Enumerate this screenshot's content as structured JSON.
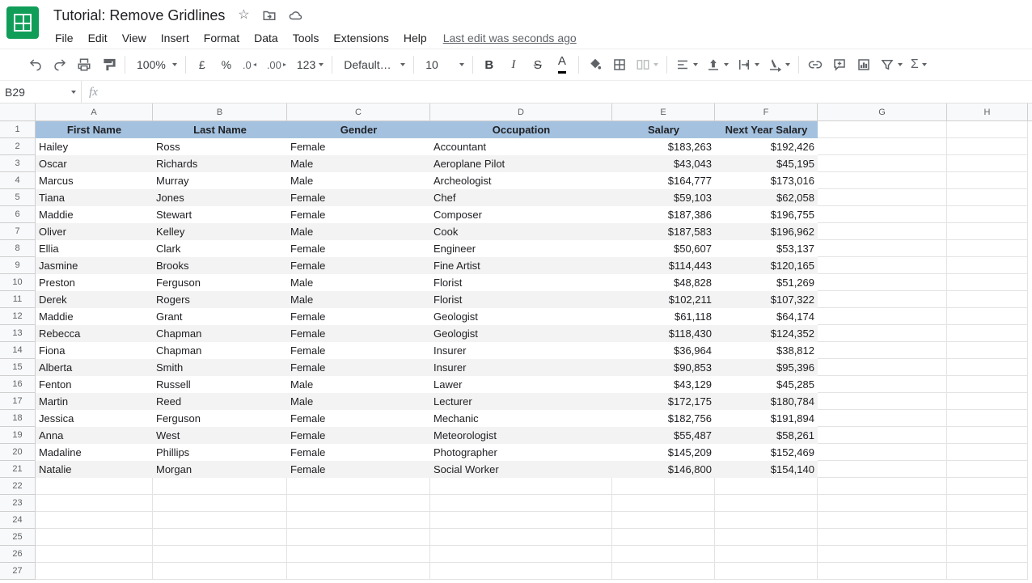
{
  "doc": {
    "title": "Tutorial: Remove Gridlines",
    "last_edit": "Last edit was seconds ago"
  },
  "menu": [
    "File",
    "Edit",
    "View",
    "Insert",
    "Format",
    "Data",
    "Tools",
    "Extensions",
    "Help"
  ],
  "toolbar": {
    "zoom": "100%",
    "currency_symbol": "£",
    "number_format_label": "123",
    "font_name": "Default (Ari…",
    "font_size": "10"
  },
  "namebox": "B29",
  "columns": [
    "A",
    "B",
    "C",
    "D",
    "E",
    "F",
    "G",
    "H"
  ],
  "headers": [
    "First Name",
    "Last Name",
    "Gender",
    "Occupation",
    "Salary",
    "Next Year Salary"
  ],
  "rows": [
    [
      "Hailey",
      "Ross",
      "Female",
      "Accountant",
      "$183,263",
      "$192,426"
    ],
    [
      "Oscar",
      "Richards",
      "Male",
      "Aeroplane Pilot",
      "$43,043",
      "$45,195"
    ],
    [
      "Marcus",
      "Murray",
      "Male",
      "Archeologist",
      "$164,777",
      "$173,016"
    ],
    [
      "Tiana",
      "Jones",
      "Female",
      "Chef",
      "$59,103",
      "$62,058"
    ],
    [
      "Maddie",
      "Stewart",
      "Female",
      "Composer",
      "$187,386",
      "$196,755"
    ],
    [
      "Oliver",
      "Kelley",
      "Male",
      "Cook",
      "$187,583",
      "$196,962"
    ],
    [
      "Ellia",
      "Clark",
      "Female",
      "Engineer",
      "$50,607",
      "$53,137"
    ],
    [
      "Jasmine",
      "Brooks",
      "Female",
      "Fine Artist",
      "$114,443",
      "$120,165"
    ],
    [
      "Preston",
      "Ferguson",
      "Male",
      "Florist",
      "$48,828",
      "$51,269"
    ],
    [
      "Derek",
      "Rogers",
      "Male",
      "Florist",
      "$102,211",
      "$107,322"
    ],
    [
      "Maddie",
      "Grant",
      "Female",
      "Geologist",
      "$61,118",
      "$64,174"
    ],
    [
      "Rebecca",
      "Chapman",
      "Female",
      "Geologist",
      "$118,430",
      "$124,352"
    ],
    [
      "Fiona",
      "Chapman",
      "Female",
      "Insurer",
      "$36,964",
      "$38,812"
    ],
    [
      "Alberta",
      "Smith",
      "Female",
      "Insurer",
      "$90,853",
      "$95,396"
    ],
    [
      "Fenton",
      "Russell",
      "Male",
      "Lawer",
      "$43,129",
      "$45,285"
    ],
    [
      "Martin",
      "Reed",
      "Male",
      "Lecturer",
      "$172,175",
      "$180,784"
    ],
    [
      "Jessica",
      "Ferguson",
      "Female",
      "Mechanic",
      "$182,756",
      "$191,894"
    ],
    [
      "Anna",
      "West",
      "Female",
      "Meteorologist",
      "$55,487",
      "$58,261"
    ],
    [
      "Madaline",
      "Phillips",
      "Female",
      "Photographer",
      "$145,209",
      "$152,469"
    ],
    [
      "Natalie",
      "Morgan",
      "Female",
      "Social Worker",
      "$146,800",
      "$154,140"
    ]
  ],
  "total_rows": 27
}
